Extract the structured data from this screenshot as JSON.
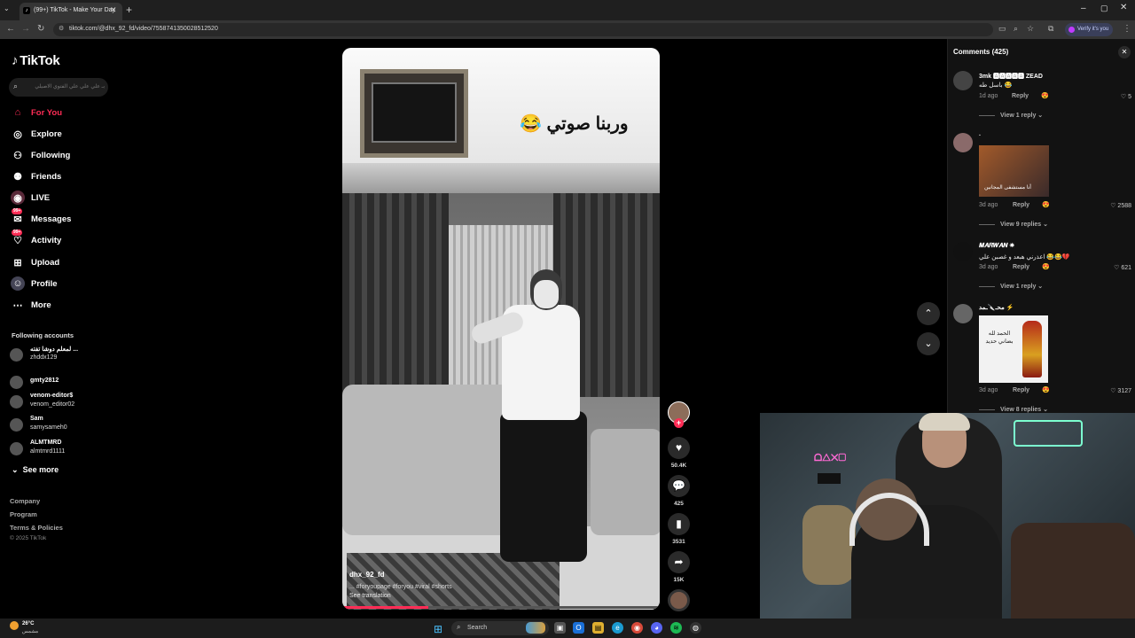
{
  "browser": {
    "tab_title": "(99+) TikTok - Make Your Day",
    "url": "tiktok.com/@dhx_92_fd/video/7558741350028512520",
    "verify_label": "Verify it's you"
  },
  "sidebar": {
    "logo": "TikTok",
    "search_placeholder": "بـ علي علي علي الفتوي الاصيلي",
    "nav": [
      {
        "label": "For You",
        "icon": "home-icon"
      },
      {
        "label": "Explore",
        "icon": "compass-icon"
      },
      {
        "label": "Following",
        "icon": "user-follow-icon"
      },
      {
        "label": "Friends",
        "icon": "friends-icon"
      },
      {
        "label": "LIVE",
        "icon": "live-icon"
      },
      {
        "label": "Messages",
        "icon": "messages-icon",
        "badge": "99+"
      },
      {
        "label": "Activity",
        "icon": "activity-icon",
        "badge": "99+"
      },
      {
        "label": "Upload",
        "icon": "upload-icon"
      },
      {
        "label": "Profile",
        "icon": "profile-icon"
      },
      {
        "label": "More",
        "icon": "more-icon"
      }
    ],
    "following_title": "Following accounts",
    "accounts": [
      {
        "name": "لمعلم دوشا تفته ...",
        "handle": "zhddx129"
      },
      {
        "name": "gmty2812",
        "handle": ""
      },
      {
        "name": "venom-editor$",
        "handle": "venom_editor02"
      },
      {
        "name": "Sam",
        "handle": "samysameh0"
      },
      {
        "name": "ALMTMRD",
        "handle": "almtmrd1111"
      }
    ],
    "see_more": "See more",
    "footer": [
      "Company",
      "Program",
      "Terms & Policies"
    ],
    "copyright": "© 2025 TikTok"
  },
  "video": {
    "overlay_text": "وربنا صوتي 😂",
    "username": "dhx_92_fd",
    "tags": "... #foryoupage #foryou #viral #shorts",
    "see_translation": "See translation",
    "progress": 0.27,
    "likes": "50.4K",
    "comments": "425",
    "saves": "3531",
    "shares": "15K"
  },
  "comments": {
    "title": "Comments (425)",
    "items": [
      {
        "name": "3mk 🅰🅰🅰🅰🅰 ZEAD",
        "text": "باسل طه 😂",
        "time": "1d ago",
        "likes": "5",
        "view": "View 1 reply"
      },
      {
        "name": ".",
        "image_caption": "أنا مستشفى المجانين",
        "time": "3d ago",
        "likes": "2588",
        "view": "View 9 replies"
      },
      {
        "name": "𝑴𝑨𝑹𝑾𝑨𝑵 ✵",
        "text": "اعذرني هبعد و غصبن علي 😂😂💔",
        "time": "3d ago",
        "likes": "621",
        "view": "View 1 reply"
      },
      {
        "name": "محـ🔪ـمد ⚡",
        "image_caption": "الحمد لله بضاني حديد",
        "time": "3d ago",
        "likes": "3127",
        "view": "View 8 replies"
      }
    ],
    "reply_label": "Reply"
  },
  "taskbar": {
    "temp": "26°C",
    "condition": "مشمس",
    "search_label": "Search"
  },
  "webcam": {
    "neon_sign": "ᗝ△✕▢"
  },
  "colors": {
    "accent": "#fe2c55",
    "background": "#000000",
    "panel": "#121212"
  }
}
